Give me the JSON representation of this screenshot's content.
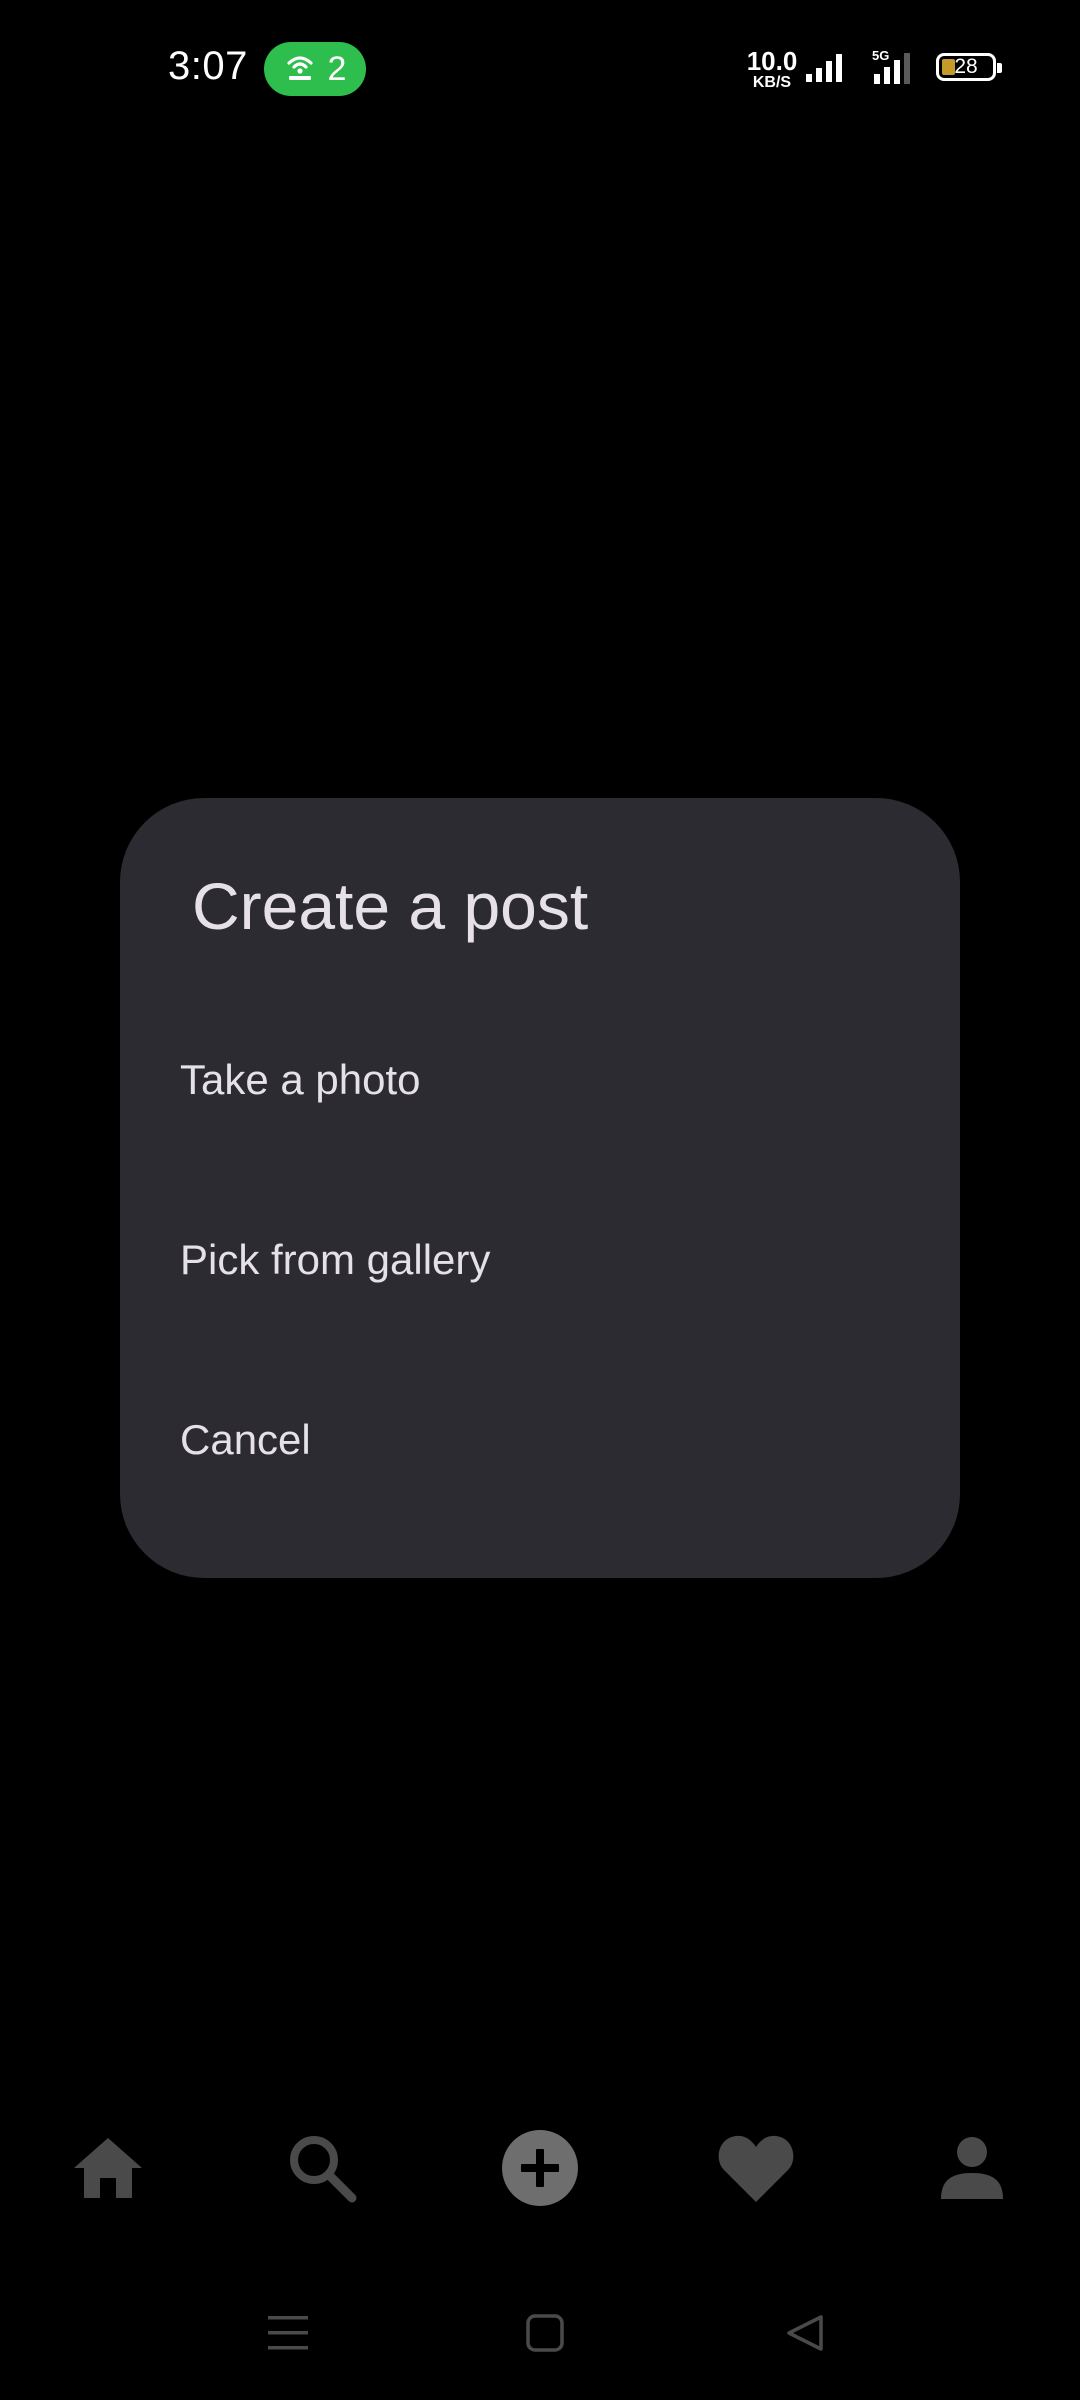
{
  "status_bar": {
    "time": "3:07",
    "hotspot_count": "2",
    "net_speed_value": "10.0",
    "net_speed_unit": "KB/S",
    "network_type": "5G",
    "battery_level": "28",
    "hotspot_color": "#2dbe4e",
    "battery_fill_color": "#c49a2a"
  },
  "dialog": {
    "title": "Create a post",
    "options": [
      {
        "label": "Take a photo"
      },
      {
        "label": "Pick from gallery"
      },
      {
        "label": "Cancel"
      }
    ],
    "background_color": "#2c2b31"
  },
  "bottom_nav": {
    "items": [
      {
        "icon": "home-icon"
      },
      {
        "icon": "search-icon"
      },
      {
        "icon": "add-post-icon"
      },
      {
        "icon": "heart-icon"
      },
      {
        "icon": "profile-icon"
      }
    ],
    "icon_color": "#4a4a4a"
  },
  "system_nav": {
    "items": [
      {
        "icon": "menu-icon"
      },
      {
        "icon": "home-square-icon"
      },
      {
        "icon": "back-triangle-icon"
      }
    ]
  }
}
